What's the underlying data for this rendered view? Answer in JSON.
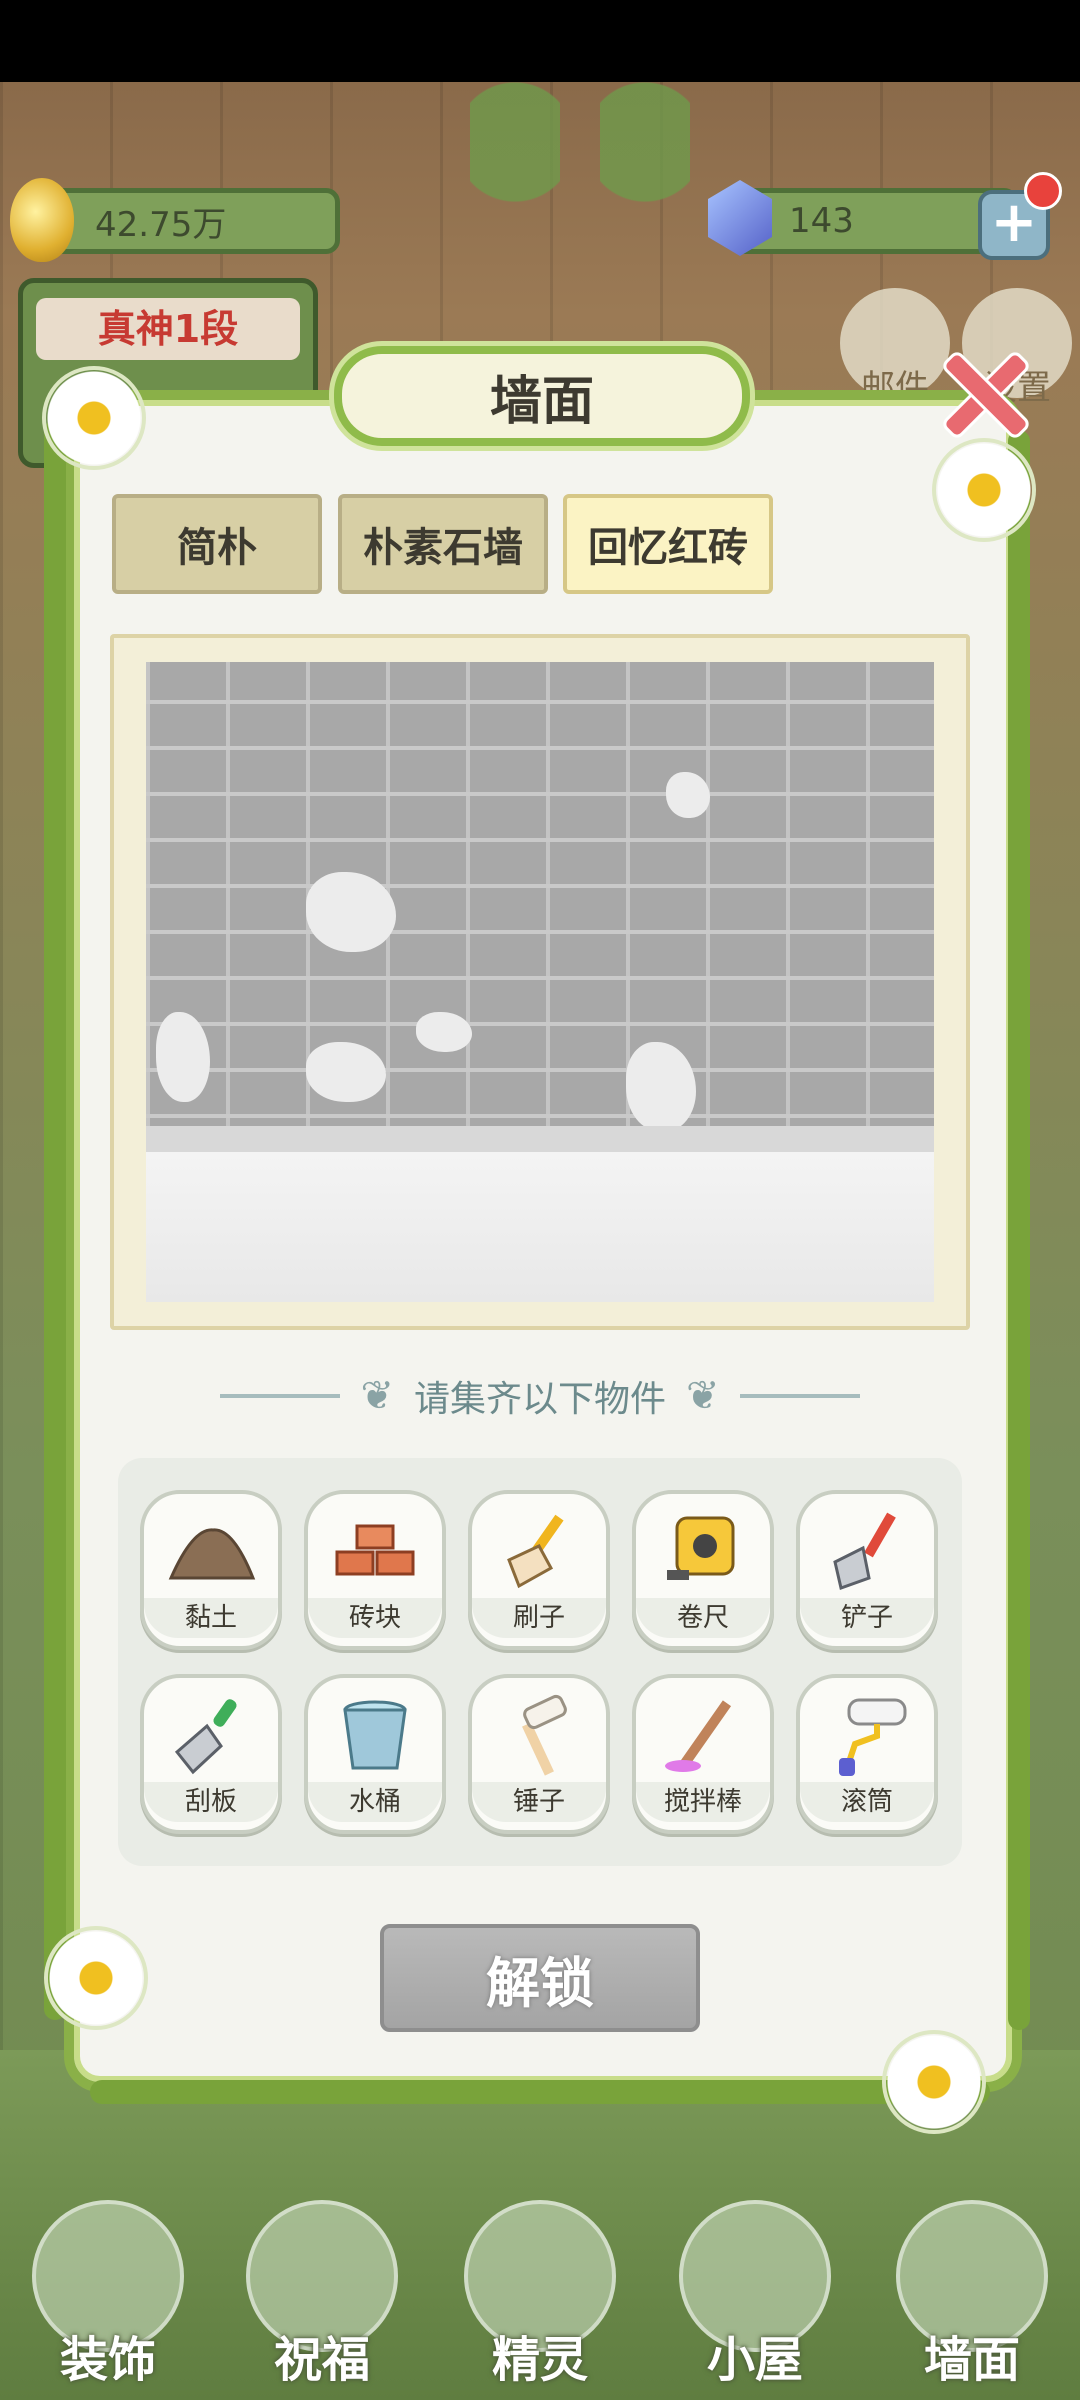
{
  "hud": {
    "gold_value": "42.75万",
    "gem_value": "143",
    "add_symbol": "+",
    "rank_title": "真神1段",
    "mail_label": "邮件",
    "settings_label": "设置"
  },
  "modal": {
    "title": "墙面",
    "tabs": [
      {
        "label": "简朴",
        "active": false
      },
      {
        "label": "朴素石墙",
        "active": false
      },
      {
        "label": "回忆红砖",
        "active": true
      }
    ],
    "requirements_heading": "请集齐以下物件",
    "items": [
      {
        "label": "黏土",
        "icon": "clay-icon"
      },
      {
        "label": "砖块",
        "icon": "bricks-icon"
      },
      {
        "label": "刷子",
        "icon": "brush-icon"
      },
      {
        "label": "卷尺",
        "icon": "tape-measure-icon"
      },
      {
        "label": "铲子",
        "icon": "shovel-icon"
      },
      {
        "label": "刮板",
        "icon": "scraper-icon"
      },
      {
        "label": "水桶",
        "icon": "bucket-icon"
      },
      {
        "label": "锤子",
        "icon": "hammer-icon"
      },
      {
        "label": "搅拌棒",
        "icon": "stir-stick-icon"
      },
      {
        "label": "滚筒",
        "icon": "paint-roller-icon"
      }
    ],
    "unlock_label": "解锁"
  },
  "nav": [
    {
      "label": "装饰",
      "icon": "plant-icon"
    },
    {
      "label": "祝福",
      "icon": "butterfly-icon"
    },
    {
      "label": "精灵",
      "icon": "fairy-icon"
    },
    {
      "label": "小屋",
      "icon": "house-icon"
    },
    {
      "label": "墙面",
      "icon": "bell-icon"
    }
  ]
}
